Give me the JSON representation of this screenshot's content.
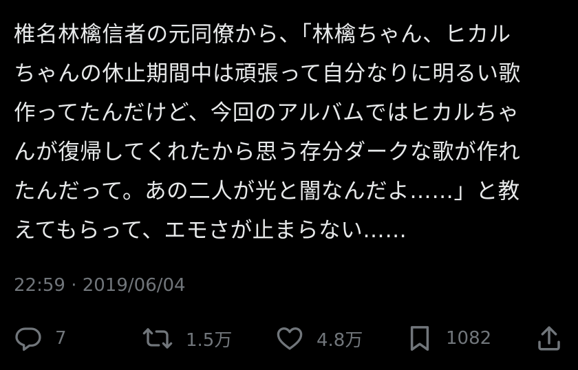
{
  "tweet": {
    "lines": [
      "椎名林檎信者の元同僚から、「林檎ちゃん、ヒカル",
      "ちゃんの休止期間中は頑張って自分なりに明るい歌",
      "作ってたんだけど、今回のアルバムではヒカルちゃ",
      "んが復帰してくれたから思う存分ダークな歌が作れ",
      "たんだって。あの二人が光と闇なんだよ……」と教",
      "えてもらって、エモさが止まらない……"
    ],
    "timestamp": "22:59 · 2019/06/04"
  },
  "actions": {
    "reply": {
      "icon": "reply-icon",
      "count": "7"
    },
    "retweet": {
      "icon": "retweet-icon",
      "count": "1.5万"
    },
    "like": {
      "icon": "heart-icon",
      "count": "4.8万"
    },
    "bookmark": {
      "icon": "bookmark-icon",
      "count": "1082"
    },
    "share": {
      "icon": "share-icon"
    }
  },
  "colors": {
    "background": "#000000",
    "text": "#e7e9ea",
    "secondary": "#71767b"
  }
}
